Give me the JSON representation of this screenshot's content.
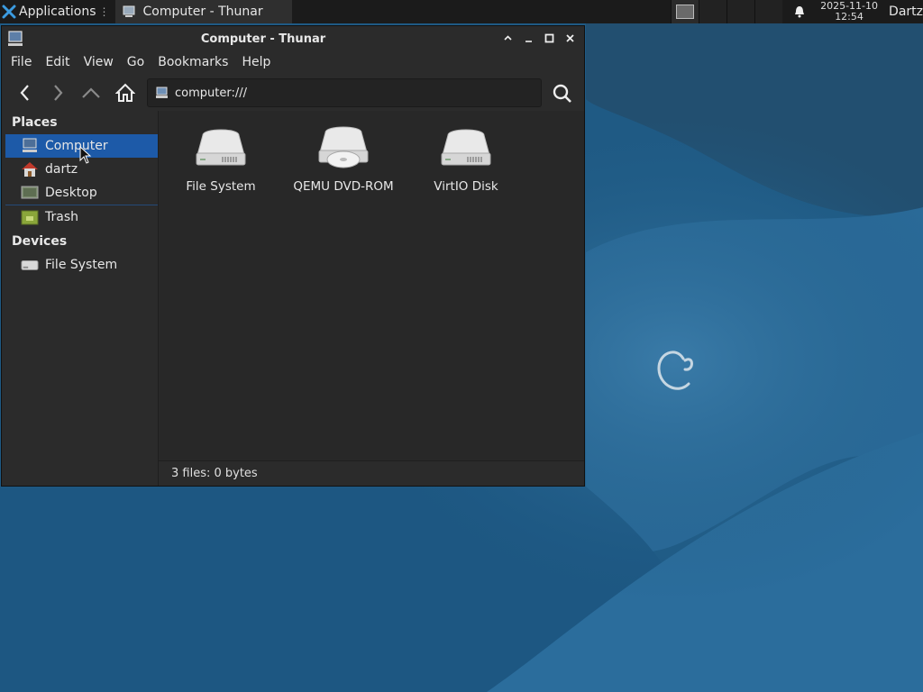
{
  "panel": {
    "apps_label": "Applications",
    "task_label": "Computer - Thunar",
    "clock_date": "2025-11-10",
    "clock_time": "12:54",
    "user": "Dartz"
  },
  "window": {
    "title": "Computer - Thunar",
    "menu": [
      "File",
      "Edit",
      "View",
      "Go",
      "Bookmarks",
      "Help"
    ],
    "location": "computer:///",
    "sidebar": {
      "places_header": "Places",
      "places": [
        {
          "label": "Computer",
          "icon": "computer-icon",
          "selected": true
        },
        {
          "label": "dartz",
          "icon": "home-folder-icon"
        },
        {
          "label": "Desktop",
          "icon": "desktop-icon"
        },
        {
          "label": "Trash",
          "icon": "trash-icon"
        }
      ],
      "devices_header": "Devices",
      "devices": [
        {
          "label": "File System",
          "icon": "drive-icon"
        }
      ]
    },
    "files": [
      {
        "label": "File System",
        "icon": "harddisk-icon"
      },
      {
        "label": "QEMU DVD-ROM",
        "icon": "optical-drive-icon"
      },
      {
        "label": "VirtIO Disk",
        "icon": "harddisk-icon"
      }
    ],
    "status": "3 files: 0 bytes"
  },
  "colors": {
    "selection": "#1d5aa8",
    "desktop": "#1e5a84",
    "window_bg": "#2b2b2b"
  }
}
